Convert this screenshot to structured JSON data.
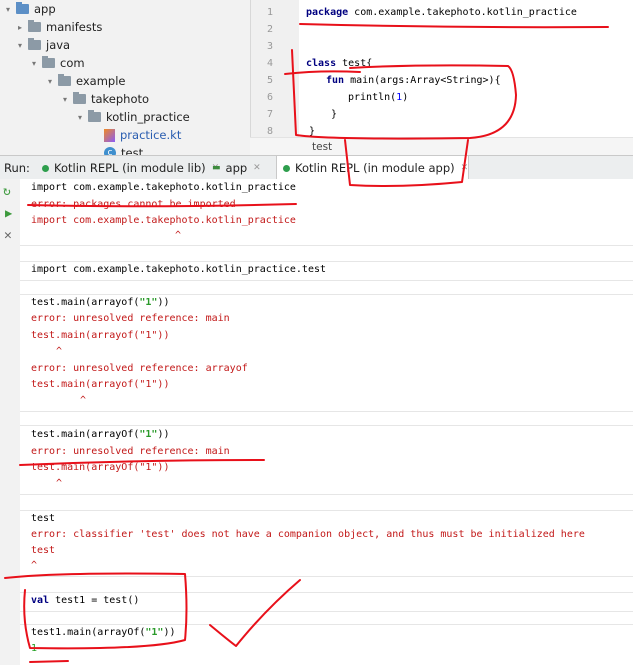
{
  "project_tree": {
    "items": [
      {
        "label": "app",
        "depth": 0,
        "arrow": "▾",
        "icon": "app-module-icon"
      },
      {
        "label": "manifests",
        "depth": 1,
        "arrow": "▸",
        "icon": "folder-icon"
      },
      {
        "label": "java",
        "depth": 1,
        "arrow": "▾",
        "icon": "folder-icon"
      },
      {
        "label": "com",
        "depth": 2,
        "arrow": "▾",
        "icon": "package-icon"
      },
      {
        "label": "example",
        "depth": 3,
        "arrow": "▾",
        "icon": "package-icon"
      },
      {
        "label": "takephoto",
        "depth": 4,
        "arrow": "▾",
        "icon": "package-icon"
      },
      {
        "label": "kotlin_practice",
        "depth": 5,
        "arrow": "▾",
        "icon": "package-icon"
      },
      {
        "label": "practice.kt",
        "depth": 6,
        "arrow": "",
        "icon": "kotlin-file-icon"
      },
      {
        "label": "test",
        "depth": 6,
        "arrow": "",
        "icon": "class-icon"
      }
    ]
  },
  "editor": {
    "line_numbers": [
      "1",
      "2",
      "3",
      "4",
      "5",
      "6",
      "7",
      "8"
    ],
    "line1_kw": "package",
    "line1_rest": " com.example.takephoto.kotlin_practice",
    "line4_kw": "class",
    "line4_rest": " test{",
    "line5_kw": "fun",
    "line5_rest": " main(args:Array<String>){",
    "line6_pre": "println(",
    "line6_num": "1",
    "line6_post": ")",
    "line7": "}",
    "line8": "}",
    "breadcrumb": "test"
  },
  "run_bar": {
    "run_label": "Run:",
    "tabs": [
      "Kotlin REPL (in module lib)",
      "app",
      "Kotlin REPL (in module app)"
    ]
  },
  "console": {
    "l1": "import com.example.takephoto.kotlin_practice",
    "l2": "error: packages cannot be imported",
    "l3": "import com.example.takephoto.kotlin_practice",
    "l4": "^",
    "l5": "import com.example.takephoto.kotlin_practice.test",
    "l6a": "test.main(arrayof(",
    "l6s": "\"1\"",
    "l6b": "))",
    "l7": "error: unresolved reference: main",
    "l8": "test.main(arrayof(\"1\"))",
    "l9": "^",
    "l10": "error: unresolved reference: arrayof",
    "l11": "test.main(arrayof(\"1\"))",
    "l12": "^",
    "l13a": "test.main(arrayOf(",
    "l13s": "\"1\"",
    "l13b": "))",
    "l14": "error: unresolved reference: main",
    "l15": "test.main(arrayOf(\"1\"))",
    "l16": "^",
    "l17": "test",
    "l18": "error: classifier 'test' does not have a companion object, and thus must be initialized here",
    "l19": "test",
    "l20": "^",
    "l21kw": "val",
    "l21rest": " test1 = test()",
    "l22a": "test1.main(arrayOf(",
    "l22s": "\"1\"",
    "l22b": "))",
    "l23": "1"
  },
  "colors": {
    "annotation": "#e8101a",
    "error": "#c21818",
    "keyword": "#000080",
    "string": "#2a9a2a"
  }
}
